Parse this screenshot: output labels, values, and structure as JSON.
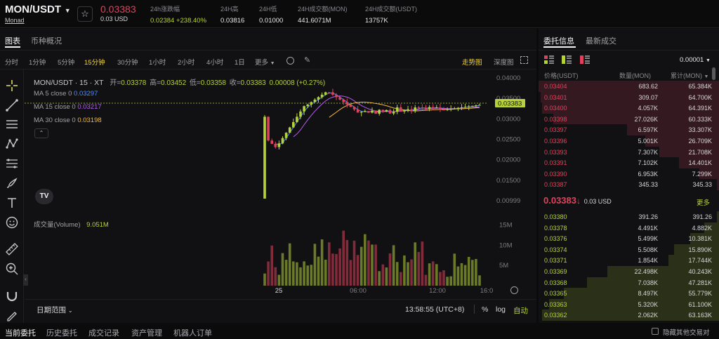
{
  "header": {
    "symbol": "MON/USDT",
    "project": "Monad",
    "price": "0.03383",
    "price_usd": "0.03 USD",
    "stats": [
      {
        "label": "24h涨跌幅",
        "value": "0.02384 +238.40%",
        "color": "#b6d23a"
      },
      {
        "label": "24H高",
        "value": "0.03816",
        "color": "#e6e6e8"
      },
      {
        "label": "24H低",
        "value": "0.01000",
        "color": "#e6e6e8"
      },
      {
        "label": "24H成交额(MON)",
        "value": "441.6071M",
        "color": "#e6e6e8"
      },
      {
        "label": "24H成交额(USDT)",
        "value": "13757K",
        "color": "#e6e6e8"
      }
    ]
  },
  "chart_tabs": {
    "chart": "图表",
    "overview": "币种概况"
  },
  "timeframes": [
    "分时",
    "1分钟",
    "5分钟",
    "15分钟",
    "30分钟",
    "1小时",
    "2小时",
    "4小时",
    "1日",
    "更多"
  ],
  "active_timeframe": "15分钟",
  "chart_modes": {
    "trend": "走势图",
    "depth": "深度图"
  },
  "ohlc": {
    "title": "MON/USDT · 15 · XT",
    "open_label": "开=",
    "open": "0.03378",
    "high_label": "高=",
    "high": "0.03452",
    "low_label": "低=",
    "low": "0.03358",
    "close_label": "收=",
    "close": "0.03383",
    "change": "0.00008 (+0.27%)"
  },
  "ma": [
    {
      "label": "MA 5 close 0",
      "value": "0.03297",
      "color": "#4a8dff"
    },
    {
      "label": "MA 15 close 0",
      "value": "0.03217",
      "color": "#b45cf0"
    },
    {
      "label": "MA 30 close 0",
      "value": "0.03198",
      "color": "#f2b73a"
    }
  ],
  "volume": {
    "label": "成交量(Volume)",
    "value": "9.051M"
  },
  "chart_data": {
    "type": "candlestick",
    "y_ticks": [
      "0.04000",
      "0.03500",
      "0.03000",
      "0.02500",
      "0.02000",
      "0.01500",
      "0.00999"
    ],
    "y_range": [
      0.00999,
      0.04
    ],
    "last_price_tag": "0.03383",
    "x_ticks": [
      "25",
      "06:00",
      "12:00",
      "16:0"
    ],
    "vol_ticks": [
      "15M",
      "10M",
      "5M"
    ],
    "vol_range": [
      0,
      17
    ]
  },
  "chart_footer": {
    "date_range": "日期范围",
    "time": "13:58:55 (UTC+8)",
    "percent": "%",
    "log": "log",
    "auto": "自动"
  },
  "orderbook": {
    "tabs": [
      "委托信息",
      "最新成交"
    ],
    "precision": "0.00001",
    "headers": [
      "价格(USDT)",
      "数量(MON)",
      "累计(MON)"
    ],
    "asks": [
      {
        "price": "0.03404",
        "qty": "683.62",
        "total": "65.384K",
        "depth": 1.0
      },
      {
        "price": "0.03401",
        "qty": "309.07",
        "total": "64.700K",
        "depth": 0.99
      },
      {
        "price": "0.03400",
        "qty": "4.057K",
        "total": "64.391K",
        "depth": 0.98
      },
      {
        "price": "0.03398",
        "qty": "27.026K",
        "total": "60.333K",
        "depth": 0.92
      },
      {
        "price": "0.03397",
        "qty": "6.597K",
        "total": "33.307K",
        "depth": 0.51
      },
      {
        "price": "0.03396",
        "qty": "5.001K",
        "total": "26.709K",
        "depth": 0.41
      },
      {
        "price": "0.03393",
        "qty": "7.307K",
        "total": "21.708K",
        "depth": 0.33
      },
      {
        "price": "0.03391",
        "qty": "7.102K",
        "total": "14.401K",
        "depth": 0.22
      },
      {
        "price": "0.03390",
        "qty": "6.953K",
        "total": "7.299K",
        "depth": 0.11
      },
      {
        "price": "0.03387",
        "qty": "345.33",
        "total": "345.33",
        "depth": 0.01
      }
    ],
    "last_price": "0.03383",
    "last_usd": "0.03 USD",
    "more": "更多",
    "bids": [
      {
        "price": "0.03380",
        "qty": "391.26",
        "total": "391.26",
        "depth": 0.01
      },
      {
        "price": "0.03378",
        "qty": "4.491K",
        "total": "4.882K",
        "depth": 0.08
      },
      {
        "price": "0.03376",
        "qty": "5.499K",
        "total": "10.381K",
        "depth": 0.16
      },
      {
        "price": "0.03374",
        "qty": "5.508K",
        "total": "15.890K",
        "depth": 0.25
      },
      {
        "price": "0.03371",
        "qty": "1.854K",
        "total": "17.744K",
        "depth": 0.28
      },
      {
        "price": "0.03369",
        "qty": "22.498K",
        "total": "40.243K",
        "depth": 0.62
      },
      {
        "price": "0.03368",
        "qty": "7.038K",
        "total": "47.281K",
        "depth": 0.73
      },
      {
        "price": "0.03365",
        "qty": "8.497K",
        "total": "55.779K",
        "depth": 0.86
      },
      {
        "price": "0.03363",
        "qty": "5.320K",
        "total": "61.100K",
        "depth": 0.94
      },
      {
        "price": "0.03362",
        "qty": "2.062K",
        "total": "63.163K",
        "depth": 0.98
      }
    ]
  },
  "bottom_tabs": [
    "当前委托",
    "历史委托",
    "成交记录",
    "资产管理",
    "机器人订单"
  ],
  "hide_other_pairs": "隐藏其他交易对",
  "colors": {
    "up": "#b6d23a",
    "down": "#e0425d",
    "accent": "#f0d44a"
  }
}
